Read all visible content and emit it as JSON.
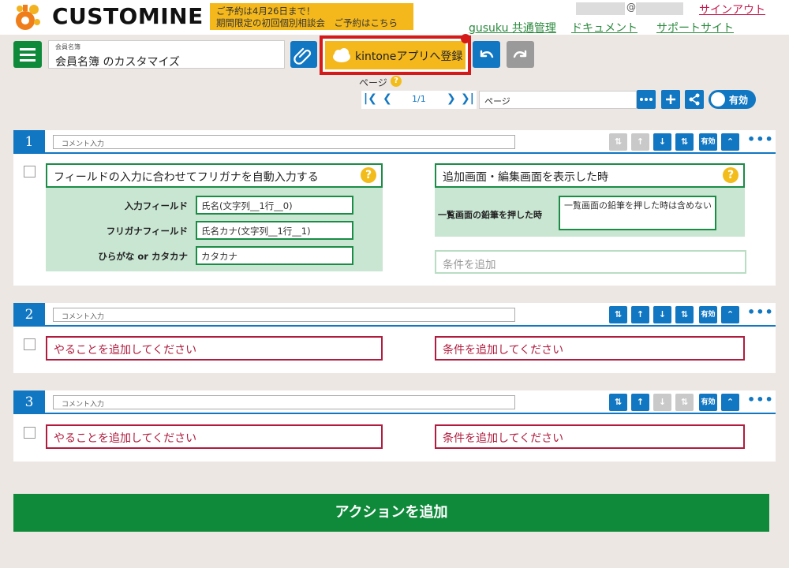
{
  "header": {
    "brand": "CUSTOMINE",
    "promo_line1": "ご予約は4月26日まで！",
    "promo_line2": "期間限定の初回個別相談会　ご予約はこちら",
    "email_at": "@",
    "signout": "サインアウト",
    "links": [
      "gusuku 共通管理",
      "ドキュメント",
      "サポートサイト"
    ]
  },
  "toolbar": {
    "app_name_label": "会員名簿",
    "app_name_value": "会員名簿 のカスタマイズ",
    "register_label": "kintoneアプリへ登録"
  },
  "pager": {
    "page_label": "ページ",
    "help": "?",
    "page_num": "1/1",
    "page_select": "ページ",
    "toggle_label": "有効"
  },
  "blocks": [
    {
      "number": "1",
      "comment_placeholder": "コメント入力",
      "enabled_label": "有効",
      "action_title": "フィールドの入力に合わせてフリガナを自動入力する",
      "fields": [
        {
          "label": "入力フィールド",
          "value": "氏名(文字列__1行__0)"
        },
        {
          "label": "フリガナフィールド",
          "value": "氏名カナ(文字列__1行__1)"
        },
        {
          "label": "ひらがな or カタカナ",
          "value": "カタカナ"
        }
      ],
      "condition_title": "追加画面・編集画面を表示した時",
      "condition_field_label": "一覧画面の鉛筆を押した時",
      "condition_field_value": "一覧画面の鉛筆を押した時は含めない",
      "add_condition_placeholder": "条件を追加"
    },
    {
      "number": "2",
      "comment_placeholder": "コメント入力",
      "enabled_label": "有効",
      "action_placeholder": "やることを追加してください",
      "condition_placeholder": "条件を追加してください"
    },
    {
      "number": "3",
      "comment_placeholder": "コメント入力",
      "enabled_label": "有効",
      "action_placeholder": "やることを追加してください",
      "condition_placeholder": "条件を追加してください"
    }
  ],
  "add_action": "アクションを追加",
  "colors": {
    "primary_green": "#0e8a3a",
    "primary_blue": "#1177c2",
    "promo_yellow": "#f4b81c",
    "alert_red": "#b01c3e",
    "light_green": "#c9e6d2"
  }
}
